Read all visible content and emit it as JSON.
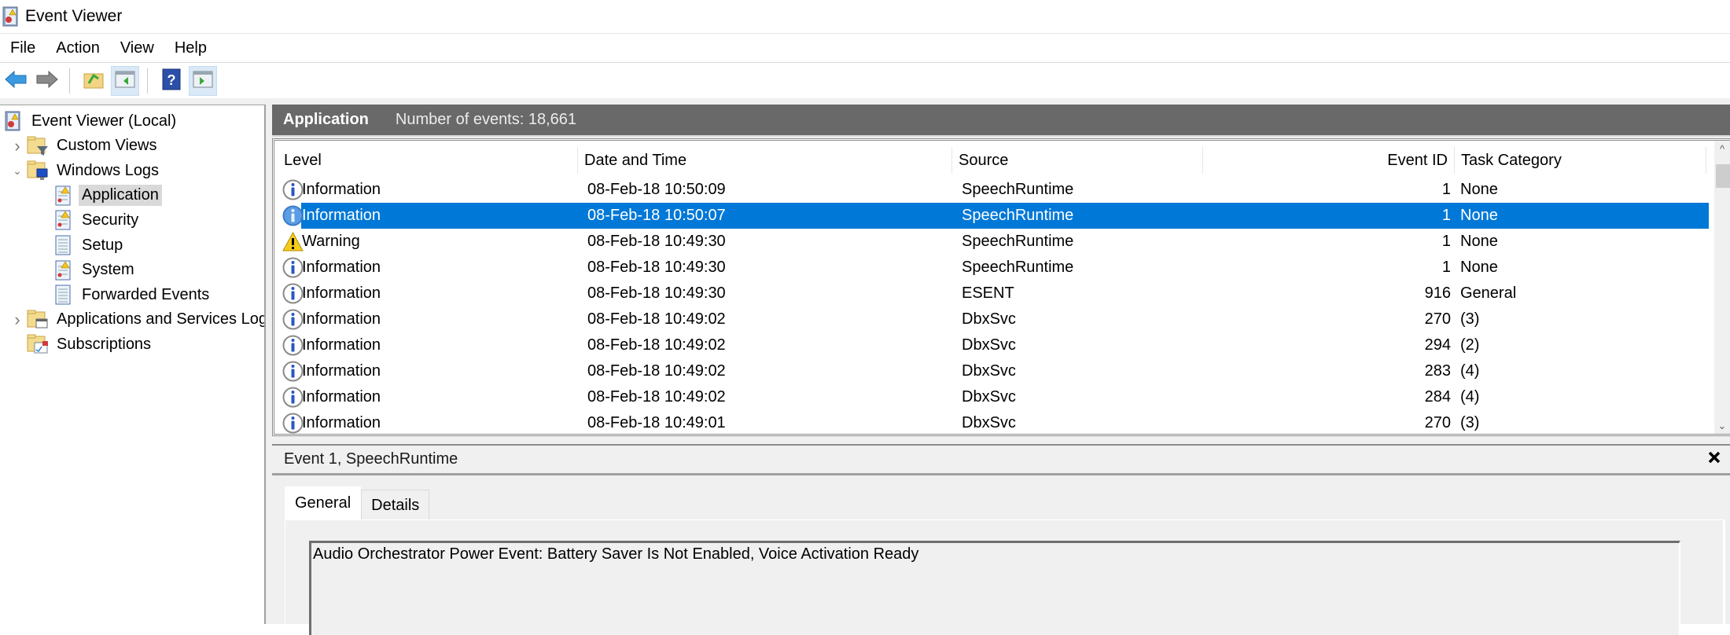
{
  "window": {
    "title": "Event Viewer",
    "icon": "event-viewer-icon"
  },
  "menu": {
    "items": [
      "File",
      "Action",
      "View",
      "Help"
    ]
  },
  "toolbar": {
    "buttons": [
      {
        "name": "back",
        "icon": "back-arrow-icon"
      },
      {
        "name": "forward",
        "icon": "forward-arrow-icon"
      },
      {
        "name": "up-one-level",
        "icon": "folder-up-icon"
      },
      {
        "name": "show-hide-console-tree",
        "icon": "console-tree-icon",
        "highlighted": true
      },
      {
        "name": "help",
        "icon": "help-icon"
      },
      {
        "name": "show-hide-action-pane",
        "icon": "action-pane-icon",
        "highlighted": true
      }
    ]
  },
  "tree": {
    "items": [
      {
        "label": "Event Viewer (Local)",
        "icon": "event-viewer-icon",
        "level": 0,
        "expander": ""
      },
      {
        "label": "Custom Views",
        "icon": "filter-folder-icon",
        "level": 1,
        "expander": "collapsed"
      },
      {
        "label": "Windows Logs",
        "icon": "windows-logs-folder-icon",
        "level": 1,
        "expander": "expanded"
      },
      {
        "label": "Application",
        "icon": "log-warning-icon",
        "level": 2,
        "selected": true
      },
      {
        "label": "Security",
        "icon": "log-warning-icon",
        "level": 2
      },
      {
        "label": "Setup",
        "icon": "log-plain-icon",
        "level": 2
      },
      {
        "label": "System",
        "icon": "log-warning-icon",
        "level": 2
      },
      {
        "label": "Forwarded Events",
        "icon": "log-plain-icon",
        "level": 2
      },
      {
        "label": "Applications and Services Logs",
        "icon": "folder-window-icon",
        "level": 1,
        "expander": "collapsed"
      },
      {
        "label": "Subscriptions",
        "icon": "subscriptions-icon",
        "level": 1,
        "expander": ""
      }
    ]
  },
  "log_header": {
    "name": "Application",
    "count_label": "Number of events: 18,661"
  },
  "table": {
    "columns": [
      "Level",
      "Date and Time",
      "Source",
      "Event ID",
      "Task Category"
    ],
    "rows": [
      {
        "level": "Information",
        "icon": "info-icon",
        "date": "08-Feb-18 10:50:09",
        "source": "SpeechRuntime",
        "id": "1",
        "task": "None"
      },
      {
        "level": "Information",
        "icon": "info-icon",
        "date": "08-Feb-18 10:50:07",
        "source": "SpeechRuntime",
        "id": "1",
        "task": "None",
        "selected": true
      },
      {
        "level": "Warning",
        "icon": "warning-icon",
        "date": "08-Feb-18 10:49:30",
        "source": "SpeechRuntime",
        "id": "1",
        "task": "None"
      },
      {
        "level": "Information",
        "icon": "info-icon",
        "date": "08-Feb-18 10:49:30",
        "source": "SpeechRuntime",
        "id": "1",
        "task": "None"
      },
      {
        "level": "Information",
        "icon": "info-icon",
        "date": "08-Feb-18 10:49:30",
        "source": "ESENT",
        "id": "916",
        "task": "General"
      },
      {
        "level": "Information",
        "icon": "info-icon",
        "date": "08-Feb-18 10:49:02",
        "source": "DbxSvc",
        "id": "270",
        "task": "(3)"
      },
      {
        "level": "Information",
        "icon": "info-icon",
        "date": "08-Feb-18 10:49:02",
        "source": "DbxSvc",
        "id": "294",
        "task": "(2)"
      },
      {
        "level": "Information",
        "icon": "info-icon",
        "date": "08-Feb-18 10:49:02",
        "source": "DbxSvc",
        "id": "283",
        "task": "(4)"
      },
      {
        "level": "Information",
        "icon": "info-icon",
        "date": "08-Feb-18 10:49:02",
        "source": "DbxSvc",
        "id": "284",
        "task": "(4)"
      },
      {
        "level": "Information",
        "icon": "info-icon",
        "date": "08-Feb-18 10:49:01",
        "source": "DbxSvc",
        "id": "270",
        "task": "(3)"
      }
    ]
  },
  "details": {
    "title": "Event 1, SpeechRuntime",
    "tabs": [
      {
        "label": "General",
        "active": true
      },
      {
        "label": "Details"
      }
    ],
    "description": "Audio Orchestrator Power Event: Battery Saver Is Not Enabled, Voice Activation Ready"
  },
  "colors": {
    "selection": "#0078d7",
    "header_bar": "#696969",
    "tree_selection": "#d9d9d9"
  }
}
